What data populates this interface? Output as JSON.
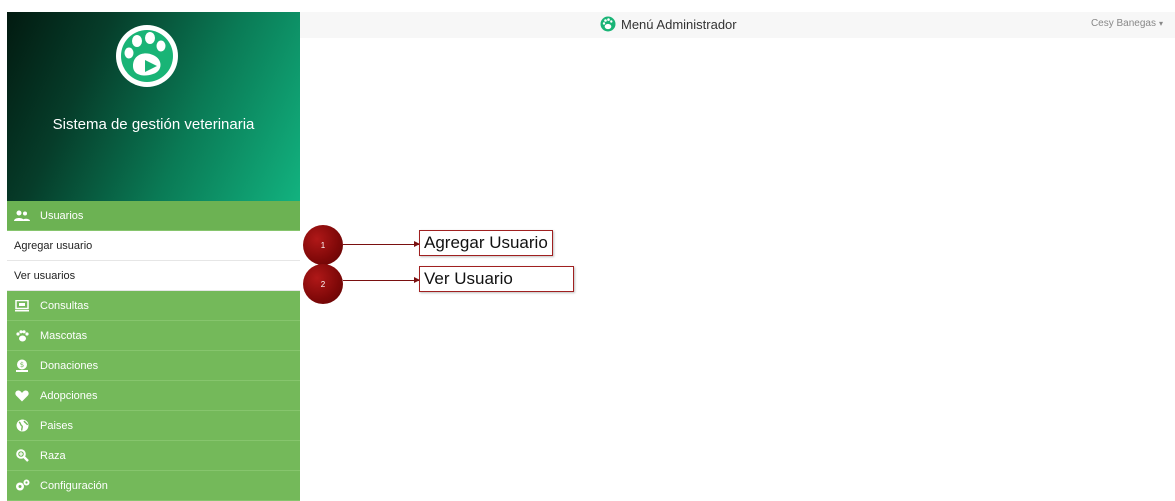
{
  "header": {
    "title": "Menú Administrador",
    "user_name": "Cesy Banegas",
    "user_caret": "▾"
  },
  "sidebar": {
    "brand_title": "Sistema de gestión veterinaria",
    "items": [
      {
        "label": "Usuarios",
        "icon": "users-icon"
      },
      {
        "label": "Consultas",
        "icon": "monitor-icon"
      },
      {
        "label": "Mascotas",
        "icon": "paw-icon"
      },
      {
        "label": "Donaciones",
        "icon": "money-icon"
      },
      {
        "label": "Adopciones",
        "icon": "heart-icon"
      },
      {
        "label": "Paises",
        "icon": "globe-icon"
      },
      {
        "label": "Raza",
        "icon": "search-icon"
      },
      {
        "label": "Configuración",
        "icon": "gears-icon"
      }
    ],
    "subitems": [
      {
        "label": "Agregar usuario"
      },
      {
        "label": "Ver usuarios"
      }
    ]
  },
  "annotations": [
    {
      "number": "1",
      "label": "Agregar Usuario"
    },
    {
      "number": "2",
      "label": "Ver Usuario"
    }
  ],
  "colors": {
    "menu_green": "#74b95a",
    "brand_gradient_start": "#021a10",
    "brand_gradient_end": "#12b27f",
    "annotation_red": "#7e0808"
  }
}
